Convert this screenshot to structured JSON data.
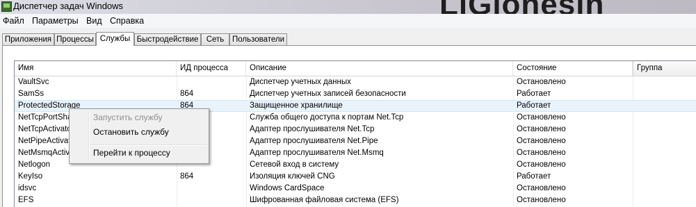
{
  "window": {
    "title": "Диспетчер задач Windows",
    "watermark": "LiGlonesin"
  },
  "menu": [
    "Файл",
    "Параметры",
    "Вид",
    "Справка"
  ],
  "tabs": [
    "Приложения",
    "Процессы",
    "Службы",
    "Быстродействие",
    "Сеть",
    "Пользователи"
  ],
  "active_tab": "Службы",
  "columns": [
    "Имя",
    "ИД процесса",
    "Описание",
    "Состояние",
    "Группа"
  ],
  "rows": [
    {
      "name": "VaultSvc",
      "pid": "",
      "description": "Диспетчер учетных данных",
      "status": "Остановлено",
      "group": ""
    },
    {
      "name": "SamSs",
      "pid": "864",
      "description": "Диспетчер учетных записей безопасности",
      "status": "Работает",
      "group": ""
    },
    {
      "name": "ProtectedStorage",
      "pid": "864",
      "description": "Защищенное хранилище",
      "status": "Работает",
      "group": ""
    },
    {
      "name": "NetTcpPortSha",
      "pid": "",
      "description": "Служба общего доступа к портам Net.Tcp",
      "status": "Остановлено",
      "group": ""
    },
    {
      "name": "NetTcpActivato",
      "pid": "",
      "description": "Адаптер прослушивателя Net.Tcp",
      "status": "Остановлено",
      "group": ""
    },
    {
      "name": "NetPipeActivat",
      "pid": "",
      "description": "Адаптер прослушивателя Net.Pipe",
      "status": "Остановлено",
      "group": ""
    },
    {
      "name": "NetMsmqActiva",
      "pid": "",
      "description": "Адаптер прослушивателя Net.Msmq",
      "status": "Остановлено",
      "group": ""
    },
    {
      "name": "Netlogon",
      "pid": "",
      "description": "Сетевой вход в систему",
      "status": "Остановлено",
      "group": ""
    },
    {
      "name": "KeyIso",
      "pid": "864",
      "description": "Изоляция ключей CNG",
      "status": "Работает",
      "group": ""
    },
    {
      "name": "idsvc",
      "pid": "",
      "description": "Windows CardSpace",
      "status": "Остановлено",
      "group": ""
    },
    {
      "name": "EFS",
      "pid": "",
      "description": "Шифрованная файловая система (EFS)",
      "status": "Остановлено",
      "group": ""
    }
  ],
  "selected_row": "ProtectedStorage",
  "context_menu": {
    "start": "Запустить службу",
    "stop": "Остановить службу",
    "goto": "Перейти к процессу"
  }
}
